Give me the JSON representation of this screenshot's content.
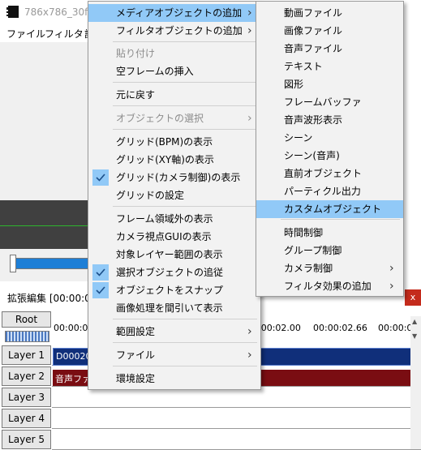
{
  "window": {
    "title": "786x786_30fps",
    "menubar": [
      "ファイル",
      "フィルタ",
      "設"
    ]
  },
  "ext_edit": {
    "title": "拡張編集 [00:00:00.",
    "close": "x",
    "root": "Root",
    "ruler": [
      "00:00:00",
      ":00:02.00",
      "00:00:02.66",
      "00:00:0"
    ],
    "layers": [
      "Layer 1",
      "Layer 2",
      "Layer 3",
      "Layer 4",
      "Layer 5"
    ],
    "clip1": "D00020",
    "clip2": "音声ファ"
  },
  "main_menu": {
    "items": [
      {
        "label": "メディアオブジェクトの追加",
        "arrow": true,
        "highlight": true
      },
      {
        "label": "フィルタオブジェクトの追加",
        "arrow": true
      },
      {
        "label": "貼り付け",
        "disabled": true
      },
      {
        "label": "空フレームの挿入"
      },
      {
        "label": "元に戻す"
      },
      {
        "label": "オブジェクトの選択",
        "arrow": true,
        "disabled": true
      },
      {
        "label": "グリッド(BPM)の表示"
      },
      {
        "label": "グリッド(XY軸)の表示"
      },
      {
        "label": "グリッド(カメラ制御)の表示",
        "checked": true
      },
      {
        "label": "グリッドの設定"
      },
      {
        "label": "フレーム領域外の表示"
      },
      {
        "label": "カメラ視点GUIの表示"
      },
      {
        "label": "対象レイヤー範囲の表示"
      },
      {
        "label": "選択オブジェクトの追従",
        "checked": true
      },
      {
        "label": "オブジェクトをスナップ",
        "checked": true
      },
      {
        "label": "画像処理を間引いて表示"
      },
      {
        "label": "範囲設定",
        "arrow": true
      },
      {
        "label": "ファイル",
        "arrow": true
      },
      {
        "label": "環境設定"
      }
    ]
  },
  "sub_menu": {
    "items": [
      {
        "label": "動画ファイル"
      },
      {
        "label": "画像ファイル"
      },
      {
        "label": "音声ファイル"
      },
      {
        "label": "テキスト"
      },
      {
        "label": "図形"
      },
      {
        "label": "フレームバッファ"
      },
      {
        "label": "音声波形表示"
      },
      {
        "label": "シーン"
      },
      {
        "label": "シーン(音声)"
      },
      {
        "label": "直前オブジェクト"
      },
      {
        "label": "パーティクル出力"
      },
      {
        "label": "カスタムオブジェクト",
        "highlight": true
      },
      {
        "label": "時間制御"
      },
      {
        "label": "グループ制御"
      },
      {
        "label": "カメラ制御",
        "arrow": true
      },
      {
        "label": "フィルタ効果の追加",
        "arrow": true
      }
    ]
  }
}
